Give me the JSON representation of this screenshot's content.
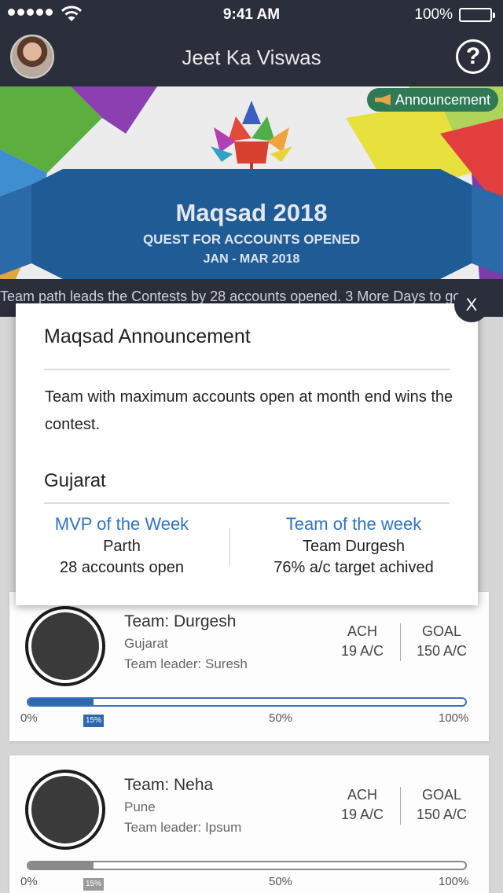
{
  "status_bar": {
    "time": "9:41 AM",
    "battery": "100%"
  },
  "header": {
    "title": "Jeet Ka Viswas",
    "help_icon": "question-mark-icon"
  },
  "banner": {
    "tag": "Announcement",
    "title": "Maqsad 2018",
    "subtitle": "QUEST FOR ACCOUNTS OPENED",
    "dates": "JAN - MAR 2018"
  },
  "ticker": {
    "text": "Team path leads the Contests by 28 accounts opened. 3 More Days to go"
  },
  "modal": {
    "title": "Maqsad Announcement",
    "description": "Team with maximum accounts open at month end wins the contest.",
    "region": "Gujarat",
    "mvp": {
      "heading": "MVP of the Week",
      "name": "Parth",
      "stat": "28 accounts open"
    },
    "team_week": {
      "heading": "Team of the week",
      "name": "Team Durgesh",
      "stat": "76% a/c target achived"
    },
    "close_label": "X"
  },
  "cards": [
    {
      "team": "Team: Durgesh",
      "city": "Gujarat",
      "leader": "Team leader: Suresh",
      "ach_label": "ACH",
      "ach_value": "19 A/C",
      "goal_label": "GOAL",
      "goal_value": "150 A/C",
      "progress_fraction": 0.15,
      "marker": "15%",
      "ticks": [
        "0%",
        "50%",
        "100%"
      ]
    },
    {
      "team": "Team: Neha",
      "city": "Pune",
      "leader": "Team leader: Ipsum",
      "ach_label": "ACH",
      "ach_value": "19 A/C",
      "goal_label": "GOAL",
      "goal_value": "150 A/C",
      "progress_fraction": 0.15,
      "marker": "15%",
      "ticks": [
        "0%",
        "50%",
        "100%"
      ]
    }
  ]
}
